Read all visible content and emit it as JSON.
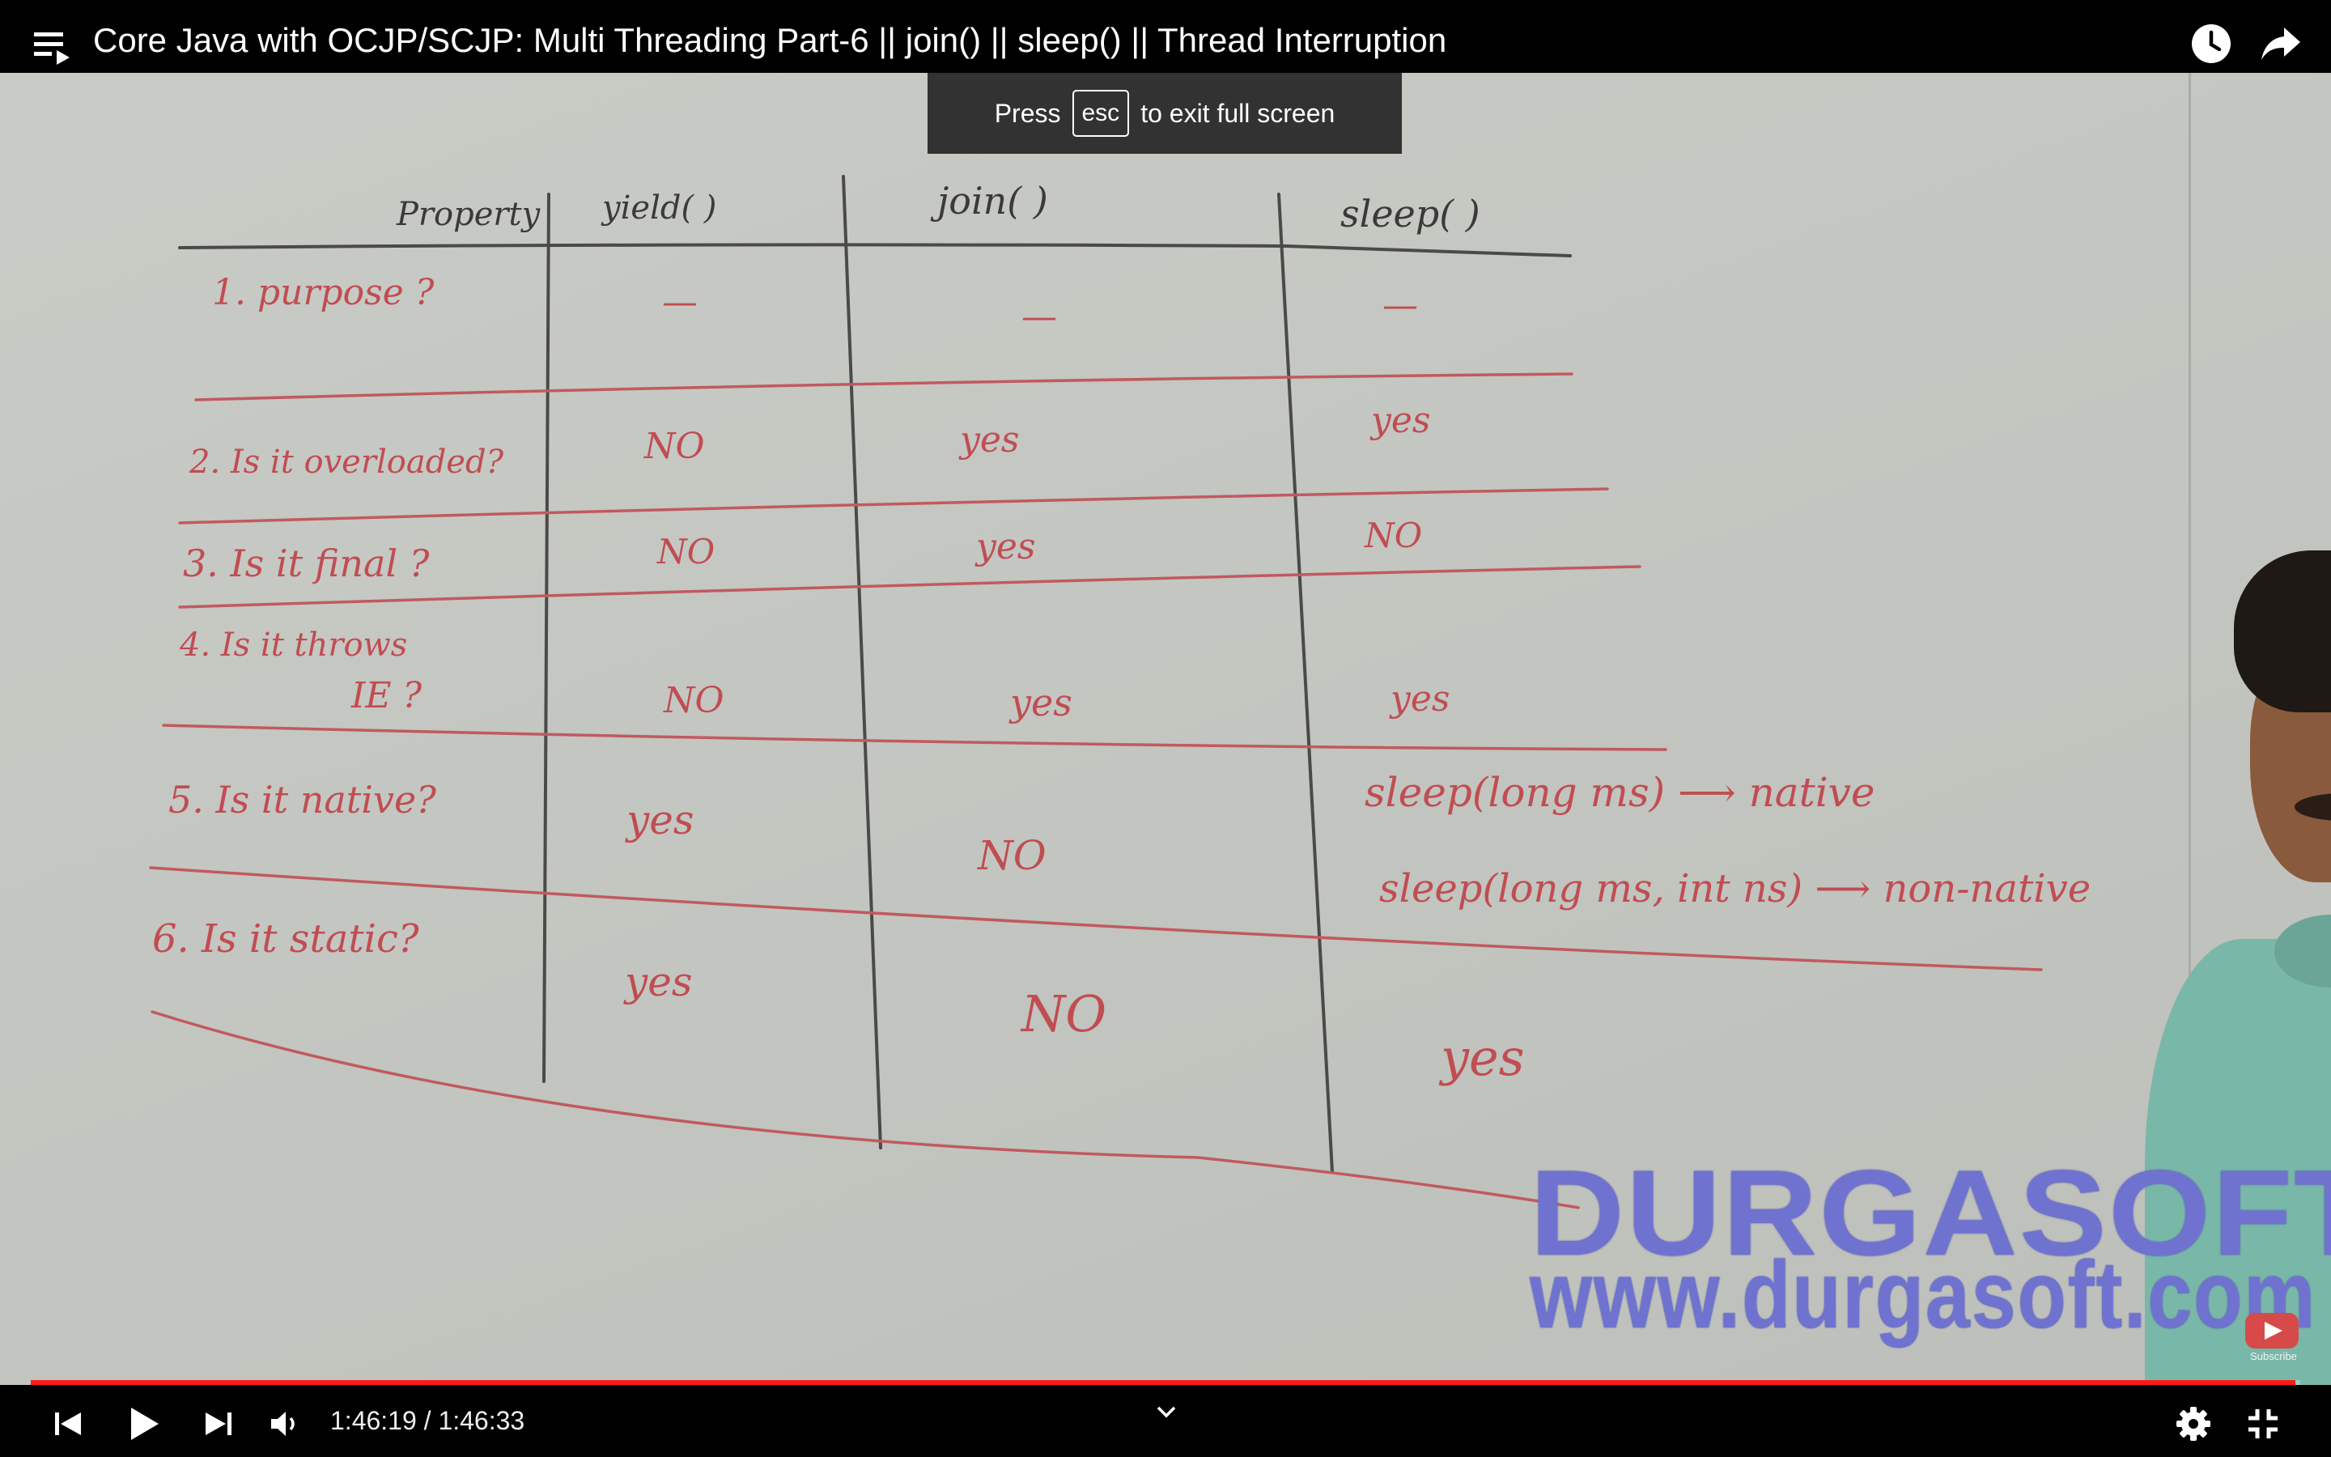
{
  "top_bar": {
    "title": "Core Java with OCJP/SCJP: Multi Threading Part-6 || join() || sleep() || Thread Interruption",
    "icons": [
      "playlist-icon",
      "watch-later-icon",
      "share-icon"
    ]
  },
  "fullscreen_toast": {
    "prefix": "Press",
    "key": "esc",
    "suffix": "to exit full screen"
  },
  "whiteboard": {
    "headers": [
      "Property",
      "yield( )",
      "join( )",
      "sleep( )"
    ],
    "rows": [
      {
        "property": "1. purpose ?",
        "yield": "—",
        "join": "—",
        "sleep": "—"
      },
      {
        "property": "2. Is it overloaded?",
        "yield": "NO",
        "join": "yes",
        "sleep": "yes"
      },
      {
        "property": "3. Is it final ?",
        "yield": "NO",
        "join": "yes",
        "sleep": "NO"
      },
      {
        "property_line1": "4. Is it throws",
        "property_line2": "IE ?",
        "yield": "NO",
        "join": "yes",
        "sleep": "yes"
      },
      {
        "property": "5. Is it native?",
        "yield": "yes",
        "join": "NO"
      },
      {
        "property": "6. Is it static?",
        "yield": "yes",
        "join": "NO",
        "sleep": "yes"
      }
    ],
    "native_notes": [
      "sleep(long ms) ⟶ native",
      "sleep(long ms, int ns) ⟶ non-native"
    ],
    "colors": {
      "ink_red": "#c04d52",
      "ink_dark": "#3a3a3a",
      "board": "#c7c9c4"
    }
  },
  "watermark": {
    "brand": "DURGASOFT",
    "url": "www.durgasoft.com",
    "subscribe_label": "Subscribe",
    "color": "#6f73cf"
  },
  "player": {
    "current_time": "1:46:19",
    "duration": "1:46:33",
    "time_display": "1:46:19 / 1:46:33",
    "progress_fraction": 0.9978,
    "accent": "#ff1a1a",
    "controls": [
      "prev-icon",
      "play-icon",
      "next-icon",
      "volume-icon",
      "chevron-down-icon",
      "gear-icon",
      "exit-fullscreen-icon"
    ]
  }
}
